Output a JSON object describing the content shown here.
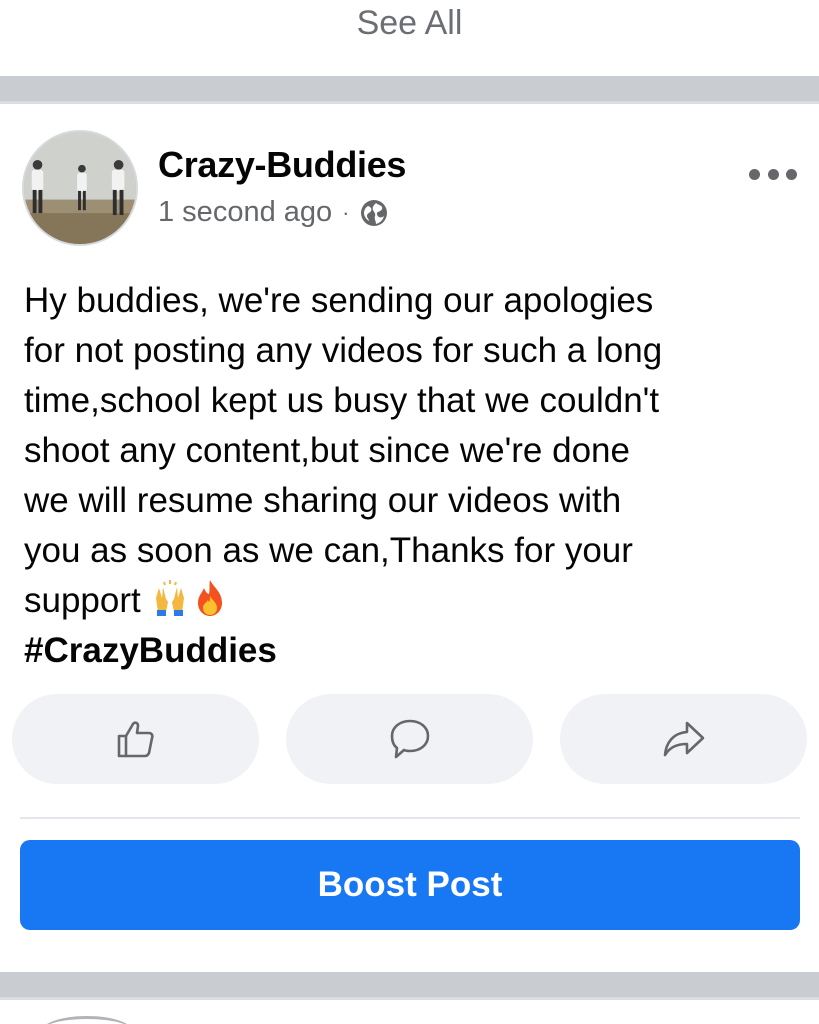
{
  "feed": {
    "see_all_label": "See All"
  },
  "post": {
    "author": "Crazy-Buddies",
    "timestamp": "1 second ago",
    "separator": "·",
    "privacy_icon": "globe-icon",
    "more_icon": "more-options-icon",
    "text": "Hy buddies, we're sending our apologies\nfor not posting any videos for such a long\ntime,school kept us busy that we couldn't\nshoot any content,but since we're done\nwe will resume sharing our videos with\nyou as soon as we can,Thanks for your\nsupport",
    "emojis": [
      "raising-hands-emoji",
      "fire-emoji"
    ],
    "hashtag": "#CrazyBuddies"
  },
  "actions": [
    {
      "icon": "like-icon"
    },
    {
      "icon": "comment-icon"
    },
    {
      "icon": "share-icon"
    }
  ],
  "boost": {
    "label": "Boost Post",
    "color": "#1877f2"
  },
  "colors": {
    "divider": "#c9ccd1",
    "action_bg": "#f0f2f5",
    "secondary_text": "#65676b"
  }
}
